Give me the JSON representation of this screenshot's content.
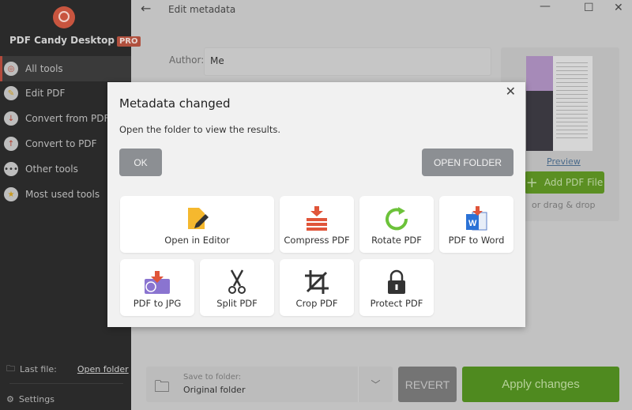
{
  "sidebar": {
    "brand": "PDF Candy Desktop",
    "badge": "PRO",
    "items": [
      {
        "label": "All tools",
        "icon": "lollipop-icon"
      },
      {
        "label": "Edit PDF",
        "icon": "edit-icon"
      },
      {
        "label": "Convert from PDF",
        "icon": "arrow-down-icon"
      },
      {
        "label": "Convert to PDF",
        "icon": "arrow-up-icon"
      },
      {
        "label": "Other tools",
        "icon": "more-icon"
      },
      {
        "label": "Most used tools",
        "icon": "star-icon"
      }
    ],
    "last_file_label": "Last file:",
    "open_folder_link": "Open folder",
    "settings": "Settings"
  },
  "header": {
    "title": "Edit metadata"
  },
  "form": {
    "author_label": "Author:",
    "author_value": "Me"
  },
  "preview": {
    "link": "Preview",
    "add_button": "Add PDF File",
    "drag_text": "or drag & drop"
  },
  "bottom": {
    "save_label": "Save to folder:",
    "save_value": "Original folder",
    "revert": "REVERT",
    "apply": "Apply changes"
  },
  "dialog": {
    "title": "Metadata changed",
    "message": "Open the folder to view the results.",
    "ok": "OK",
    "open_folder": "OPEN FOLDER",
    "tools": [
      "Open in Editor",
      "Compress PDF",
      "Rotate PDF",
      "PDF to Word",
      "PDF to JPG",
      "Split PDF",
      "Crop PDF",
      "Protect PDF"
    ]
  },
  "colors": {
    "accent": "#c8553f",
    "apply": "#4f8a1f",
    "sidebar": "#2a2a2a"
  }
}
